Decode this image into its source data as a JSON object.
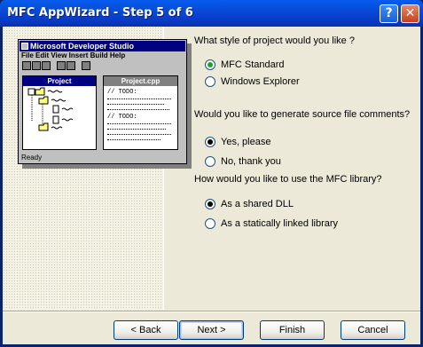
{
  "window": {
    "title": "MFC AppWizard - Step 5 of 6",
    "help_glyph": "?",
    "close_glyph": "✕"
  },
  "illustration": {
    "app_title": "Microsoft Developer Studio",
    "menu": "File Edit View Insert Build Help",
    "project_pane_title": "Project",
    "file_pane_title": "Project.cpp",
    "todo_1": "// TODO:",
    "todo_2": "// TODO:",
    "status": "Ready"
  },
  "questions": {
    "q1": "What style of project would you like ?",
    "q1_options": [
      "MFC Standard",
      "Windows Explorer"
    ],
    "q1_selected": "MFC Standard",
    "q2": "Would you like to generate source file comments?",
    "q2_options": [
      "Yes, please",
      "No, thank you"
    ],
    "q2_selected": "Yes, please",
    "q3": "How would you like to use the MFC library?",
    "q3_options": [
      "As a shared DLL",
      "As a statically linked library"
    ],
    "q3_selected": "As a shared DLL"
  },
  "buttons": {
    "back": "< Back",
    "next": "Next >",
    "finish": "Finish",
    "cancel": "Cancel"
  },
  "colors": {
    "titlebar": "#0a47d6",
    "dialog_bg": "#ece9d8",
    "radio_dot": "#21a121"
  }
}
